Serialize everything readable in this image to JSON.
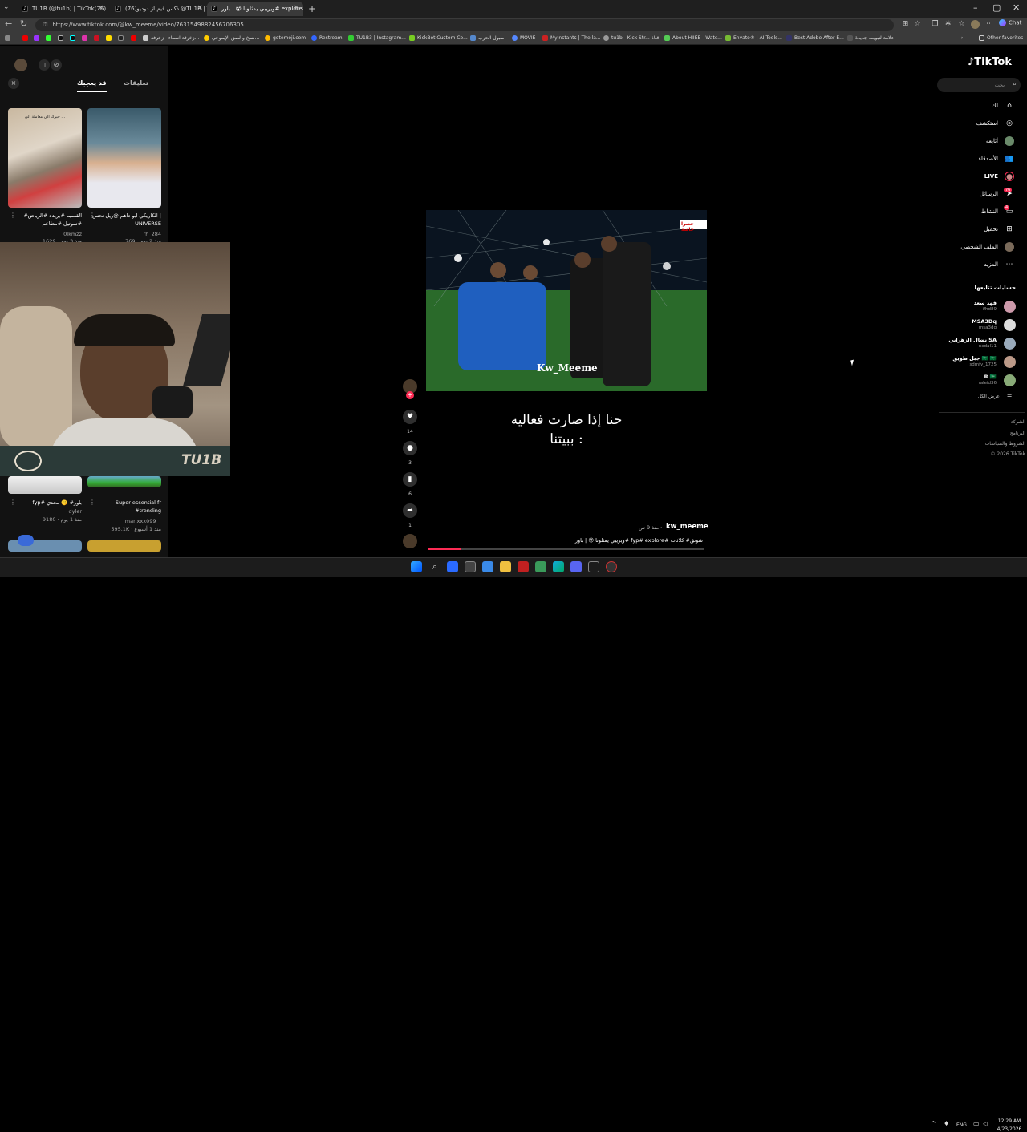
{
  "browser": {
    "tabs": [
      {
        "title": "TU1B (@tu1b) | TikTok(76)",
        "fav": "♪"
      },
      {
        "title": "(76)ذكس قيم از دوديو @TU1B | TikTok",
        "fav": "♪"
      },
      {
        "title": "ويريبي يمثلونا 😵 | باور# explore#",
        "fav": "♪"
      }
    ],
    "new_tab": "+",
    "url": "https://www.tiktok.com/@kw_meeme/video/7631549882456706305",
    "copilot_label": "Chat",
    "bookmarks": [
      "زخرفة اسماء - زخرفة...",
      "نسخ و لصق الإيموجي...",
      "getemoji.com",
      "Restream",
      "TU1B3 | Instagram...",
      "KickBot Custom Co...",
      "طبول الحرب",
      "MOVIE",
      "Myinstants | The la...",
      "tu1b - Kick Str... قناة",
      "About HIIEE - Watc...",
      "Envato® | AI Tools...",
      "Best Adobe After E...",
      "علامة لتبويب جديدة"
    ],
    "other_favorites": "Other favorites"
  },
  "left_panel": {
    "tab_for_you": "قد يعجبك",
    "tab_comments": "تعليقات",
    "thumb1_overlay": "خبرك الي معاملة الي ...",
    "videos": [
      {
        "caption": "#القسيم #بريده #الرياض #سوتيل #مطاعم",
        "user": "0lkmzz",
        "meta": "1629 · منذ 3 يوم"
      },
      {
        "caption": "الكاريكي ابو داهم @ريل نحس | UNIVERSE",
        "user": "rh_284",
        "meta": "769 · منذ 2 يوم"
      },
      {
        "caption": "fyp# باور# 🤫 محدي",
        "user": "dyler",
        "meta": "9180 · منذ 1 يوم"
      },
      {
        "caption": "Super essential fr #trending",
        "user": "marixxx099__",
        "meta": "595.1K · منذ 1 أسبوع"
      }
    ]
  },
  "webcam": {
    "brand": "TU1B"
  },
  "video": {
    "badge": "حصرا خاصة",
    "watermark": "Kw_Meeme",
    "overlay_line1": "حنا إذا صارت فعاليه",
    "overlay_line2": "ببيتنا :",
    "likes": "14",
    "comments": "3",
    "saves": "6",
    "shares": "1",
    "author": "kw_meeme",
    "time": "منذ 9 س ·",
    "description": "ويريبي يمثلونا 😵 | باور# fyp# explore# شونق# كلاثات",
    "progress": 0.12
  },
  "sidebar": {
    "logo": "TikTok",
    "search_placeholder": "بحث",
    "nav": [
      {
        "label": "لك",
        "icon": "home-icon",
        "glyph": "⌂"
      },
      {
        "label": "استكشف",
        "icon": "compass-icon",
        "glyph": "◎"
      },
      {
        "label": "أتابعه",
        "icon": "following-icon",
        "glyph": "●"
      },
      {
        "label": "الأصدقاء",
        "icon": "friends-icon",
        "glyph": "👥"
      },
      {
        "label": "LIVE",
        "icon": "live-icon",
        "glyph": "●"
      },
      {
        "label": "الرسائل",
        "icon": "messages-icon",
        "glyph": "➤"
      },
      {
        "label": "النشاط",
        "icon": "activity-icon",
        "glyph": "▭"
      },
      {
        "label": "تحميل",
        "icon": "upload-icon",
        "glyph": "⊞"
      },
      {
        "label": "الملف الشخصي",
        "icon": "profile-icon",
        "glyph": "●"
      },
      {
        "label": "المزيد",
        "icon": "more-icon",
        "glyph": "⋯"
      }
    ],
    "messages_badge": "76",
    "activity_badge": "4",
    "following_title": "حسابات تتابعها",
    "accounts": [
      {
        "name": "فهد سعد",
        "handle": "ifhd89"
      },
      {
        "name": "MSA3Dq",
        "handle": "msa3dq"
      },
      {
        "name": "نضال الزهراني SA",
        "handle": "nxdal11"
      },
      {
        "name": "جبل طويق 🇸🇦 🇸🇦",
        "handle": "sdmfy_1725"
      },
      {
        "name": "R 🇸🇦",
        "handle": "raleid36"
      }
    ],
    "show_all": "عرض الكل",
    "footer": [
      "الشركة",
      "البرنامج",
      "الشروط والسياسات",
      "© 2026 TikTok"
    ]
  },
  "taskbar": {
    "lang": "ENG",
    "time": "12:29 AM",
    "date": "4/23/2026"
  }
}
